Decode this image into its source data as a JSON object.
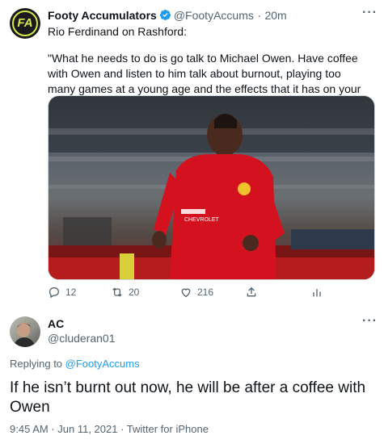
{
  "tweet": {
    "author_name": "Footy Accumulators",
    "author_handle": "@FootyAccums",
    "separator": "·",
    "time": "20m",
    "intro": "Rio Ferdinand on Rashford:",
    "quote": "\"What he needs to do is go talk to Michael Owen. Have coffee with Owen and listen to him talk about burnout, playing too many games at a young age and the effects that it has on your career for years to come.\"",
    "avatar_text": "FA",
    "actions": {
      "reply_count": "12",
      "retweet_count": "20",
      "like_count": "216"
    },
    "photo": {
      "shirt_sponsor": "CHEVROLET"
    }
  },
  "reply": {
    "author_name": "AC",
    "author_handle": "@cluderan01",
    "replying_prefix": "Replying to",
    "replying_handle": "@FootyAccums",
    "text": "If he isn’t burnt out now, he will be after a coffee with Owen",
    "meta": "9:45 AM · Jun 11, 2021 · Twitter for iPhone"
  },
  "icons": [
    "verified-badge-icon",
    "more-icon",
    "reply-icon",
    "retweet-icon",
    "like-icon",
    "share-icon",
    "analytics-icon"
  ],
  "colors": {
    "accent": "#1d9bf0",
    "secondary_text": "#536471",
    "primary_text": "#0f1419",
    "shirt_red": "#d4121f"
  }
}
